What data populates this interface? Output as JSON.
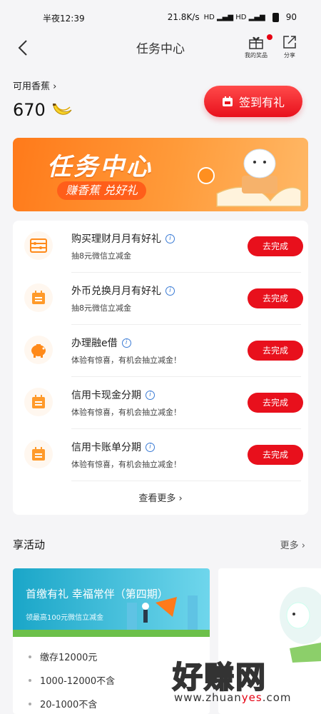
{
  "status_bar": {
    "time": "半夜12:39",
    "net_speed": "21.8K/s",
    "battery": "90"
  },
  "nav": {
    "title": "任务中心",
    "my_prizes": "我的奖品",
    "share": "分享"
  },
  "balance": {
    "label": "可用香蕉",
    "value": "670"
  },
  "sign_in_button": "签到有礼",
  "banner": {
    "title": "任务中心",
    "subtitle": "赚香蕉 兑好礼"
  },
  "tasks": [
    {
      "title": "购买理财月月有好礼",
      "desc": "抽8元微信立减金",
      "action": "去完成",
      "icon": "abacus-icon"
    },
    {
      "title": "外币兑换月月有好礼",
      "desc": "抽8元微信立减金",
      "action": "去完成",
      "icon": "calendar-icon"
    },
    {
      "title": "办理融e借",
      "desc": "体验有惊喜，有机会抽立减金！",
      "action": "去完成",
      "icon": "piggy-bank-icon"
    },
    {
      "title": "信用卡现金分期",
      "desc": "体验有惊喜，有机会抽立减金！",
      "action": "去完成",
      "icon": "calendar-icon"
    },
    {
      "title": "信用卡账单分期",
      "desc": "体验有惊喜，有机会抽立减金！",
      "action": "去完成",
      "icon": "calendar-icon"
    }
  ],
  "see_more": "查看更多",
  "activities": {
    "title": "享活动",
    "more": "更多",
    "card1": {
      "title": "首缴有礼 幸福常伴（第四期）",
      "subtitle": "领最高100元微信立减金",
      "items": [
        "缴存12000元",
        "1000-12000不含",
        "20-1000不含"
      ]
    }
  },
  "watermark": {
    "main": "好赚网",
    "url_a": "www.zhuan",
    "url_b": "yes",
    "url_c": ".com"
  },
  "colors": {
    "primary_red": "#e8101c",
    "banner_orange": "#ff8a2a",
    "card_teal": "#1aa6c8"
  }
}
